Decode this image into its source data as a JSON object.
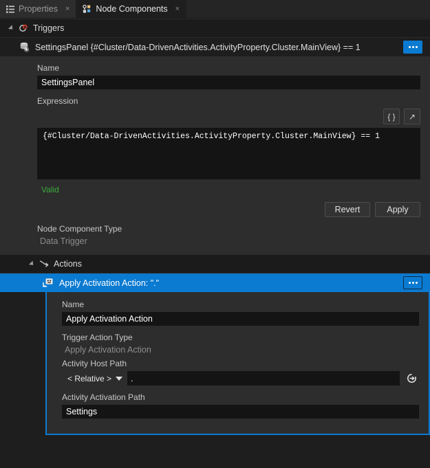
{
  "tabs": [
    {
      "label": "Properties",
      "icon": "list-icon",
      "close": "×",
      "active": false
    },
    {
      "label": "Node Components",
      "icon": "node-components-icon",
      "close": "×",
      "active": true
    }
  ],
  "triggers_group": {
    "label": "Triggers",
    "icon": "trigger-icon",
    "twisty": "expanded"
  },
  "trigger_item": {
    "label": "SettingsPanel {#Cluster/Data-DrivenActivities.ActivityProperty.Cluster.MainView} == 1",
    "icon": "data-trigger-icon",
    "menu_label": "..."
  },
  "trigger_form": {
    "name_label": "Name",
    "name_value": "SettingsPanel",
    "expression_label": "Expression",
    "braces_button": "{ }",
    "expand_button": "↗",
    "expression_value": "{#Cluster/Data-DrivenActivities.ActivityProperty.Cluster.MainView} == 1",
    "validation_status": "Valid",
    "revert_label": "Revert",
    "apply_label": "Apply",
    "type_label": "Node Component Type",
    "type_value": "Data Trigger"
  },
  "actions_group": {
    "label": "Actions",
    "icon": "action-arrow-icon",
    "twisty": "expanded"
  },
  "action_item": {
    "label": "Apply Activation Action: \".\"",
    "icon": "activation-action-icon",
    "menu_label": "..."
  },
  "action_form": {
    "name_label": "Name",
    "name_value": "Apply Activation Action",
    "trigger_action_type_label": "Trigger Action Type",
    "trigger_action_type_value": "Apply Activation Action",
    "host_path_label": "Activity Host Path",
    "host_path_mode": "< Relative >",
    "host_path_value": ".",
    "reset_icon": "reset-icon",
    "activation_path_label": "Activity Activation Path",
    "activation_path_value": "Settings"
  },
  "colors": {
    "selection_blue": "#0b7ad1",
    "valid_green": "#3bab3b",
    "panel_bg": "#2d2d2d",
    "window_bg": "#1e1e1e",
    "input_bg": "#141414"
  }
}
